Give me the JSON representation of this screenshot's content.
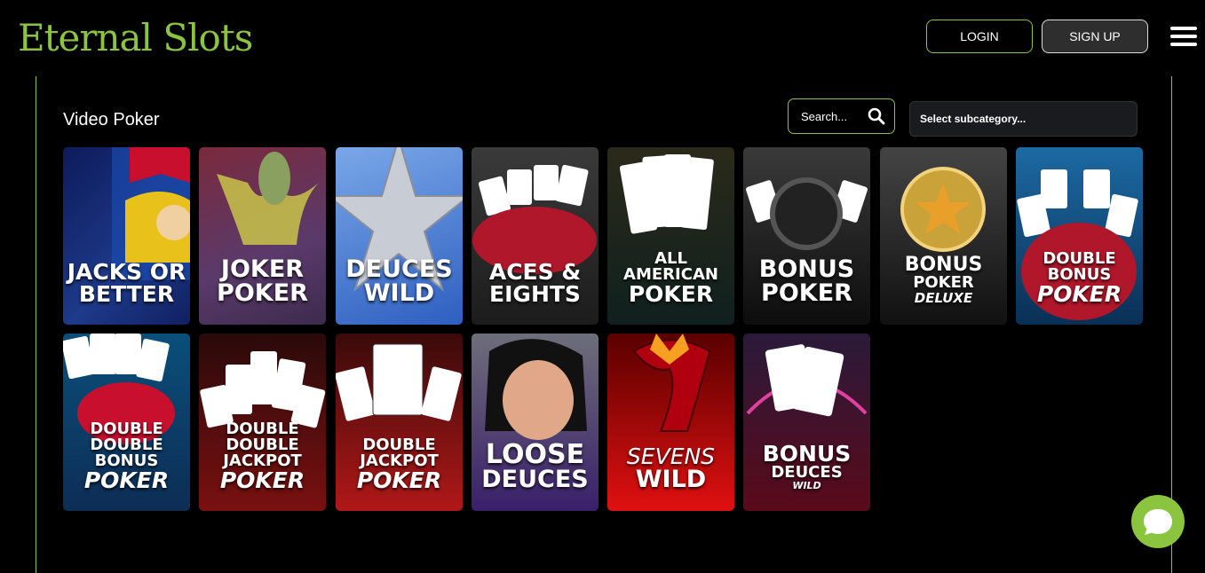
{
  "brand": {
    "name": "Eternal Slots",
    "accent": "#8bc53f"
  },
  "header": {
    "login_label": "LOGIN",
    "signup_label": "SIGN UP",
    "menu_icon": "hamburger-icon"
  },
  "section": {
    "title": "Video Poker"
  },
  "search": {
    "placeholder": "Search...",
    "icon": "search-icon"
  },
  "subcategory": {
    "selected": "Select subcategory..."
  },
  "games": [
    {
      "line1": "JACKS OR",
      "line2": "BETTER"
    },
    {
      "line1": "JOKER",
      "line2": "POKER"
    },
    {
      "line1": "DEUCES",
      "line2": "WILD"
    },
    {
      "line1": "ACES &",
      "line2": "EIGHTS"
    },
    {
      "line1": "ALL",
      "line2": "AMERICAN",
      "line3": "POKER"
    },
    {
      "line1": "BONUS",
      "line2": "POKER"
    },
    {
      "line1": "BONUS",
      "line2": "POKER",
      "line3": "DELUXE"
    },
    {
      "line1": "DOUBLE",
      "line2": "BONUS",
      "line3": "POKER"
    },
    {
      "line1": "DOUBLE DOUBLE",
      "line2": "BONUS",
      "line3": "POKER"
    },
    {
      "line1": "DOUBLE DOUBLE",
      "line2": "JACKPOT",
      "line3": "POKER"
    },
    {
      "line1": "DOUBLE",
      "line2": "JACKPOT",
      "line3": "POKER"
    },
    {
      "line1": "LOOSE",
      "line2": "DEUCES"
    },
    {
      "line1": "SEVENS",
      "line2": "WILD"
    },
    {
      "line1": "BONUS",
      "line2": "DEUCES",
      "line3": "WILD"
    }
  ],
  "chat": {
    "icon": "chat-bubble-icon"
  }
}
